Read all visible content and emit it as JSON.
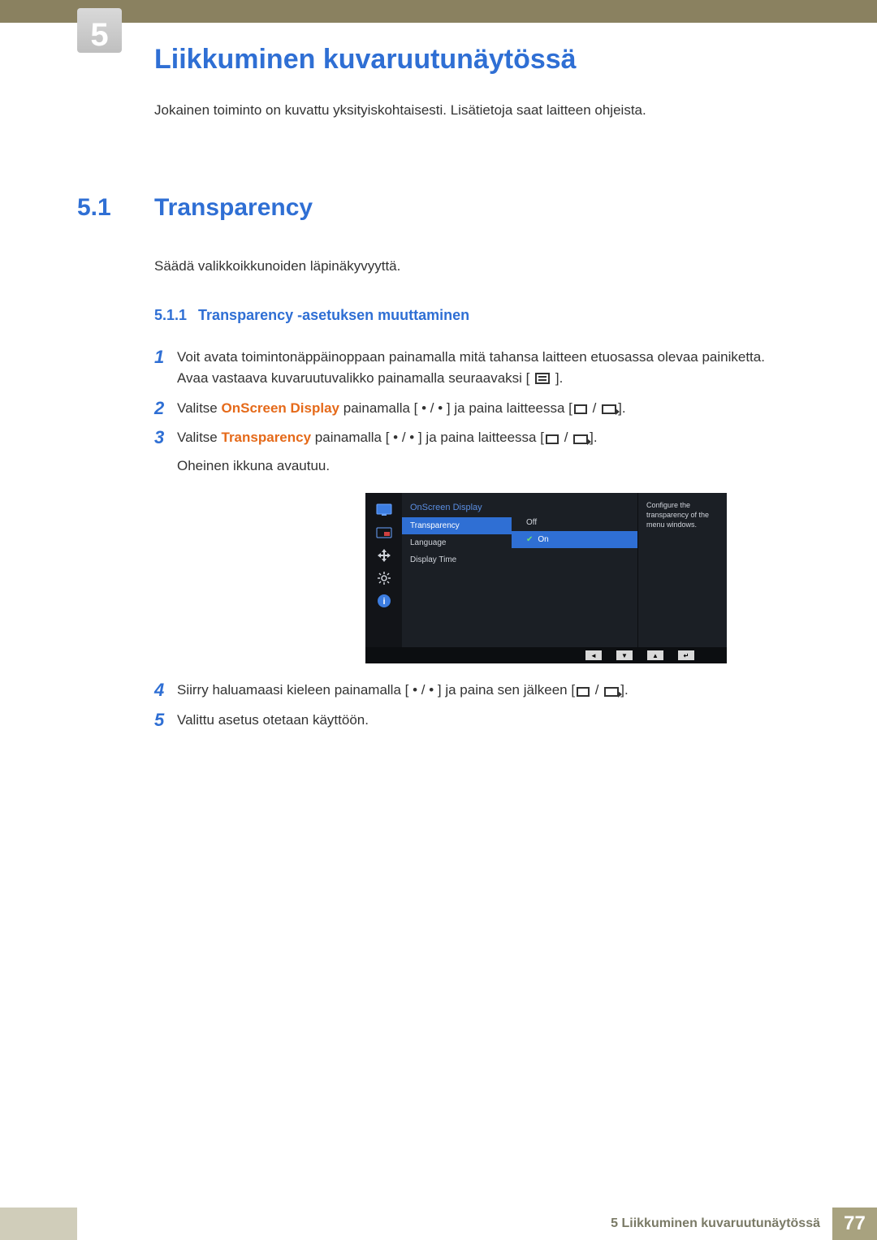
{
  "chapter_number": "5",
  "chapter_title": "Liikkuminen kuvaruutunäytössä",
  "intro": "Jokainen toiminto on kuvattu yksityiskohtaisesti. Lisätietoja saat laitteen ohjeista.",
  "section": {
    "number": "5.1",
    "title": "Transparency",
    "desc": "Säädä valikkoikkunoiden läpinäkyvyyttä."
  },
  "subsection": {
    "number": "5.1.1",
    "title": "Transparency -asetuksen muuttaminen"
  },
  "steps": {
    "s1a": "Voit avata toimintonäppäinoppaan painamalla mitä tahansa laitteen etuosassa olevaa painiketta.",
    "s1b_pre": "Avaa vastaava kuvaruutuvalikko painamalla seuraavaksi [",
    "s1b_post": "].",
    "s2_pre": "Valitse ",
    "s2_hl": "OnScreen Display",
    "s2_mid": " painamalla [ • / • ] ja paina laitteessa [",
    "s2_post": "].",
    "s3_pre": "Valitse ",
    "s3_hl": "Transparency",
    "s3_mid": " painamalla [ • / • ] ja paina laitteessa [",
    "s3_post": "].",
    "s3_after": "Oheinen ikkuna avautuu.",
    "s4_pre": "Siirry haluamaasi kieleen painamalla [ • / • ] ja paina sen jälkeen [",
    "s4_post": "].",
    "s5": "Valittu asetus otetaan käyttöön."
  },
  "osd": {
    "title": "OnScreen Display",
    "items": [
      "Transparency",
      "Language",
      "Display Time"
    ],
    "values": [
      "Off",
      "On"
    ],
    "help": "Configure the transparency of the menu windows.",
    "nav": [
      "◄",
      "▼",
      "▲",
      "↵"
    ]
  },
  "footer": {
    "label": "5 Liikkuminen kuvaruutunäytössä",
    "page": "77"
  }
}
